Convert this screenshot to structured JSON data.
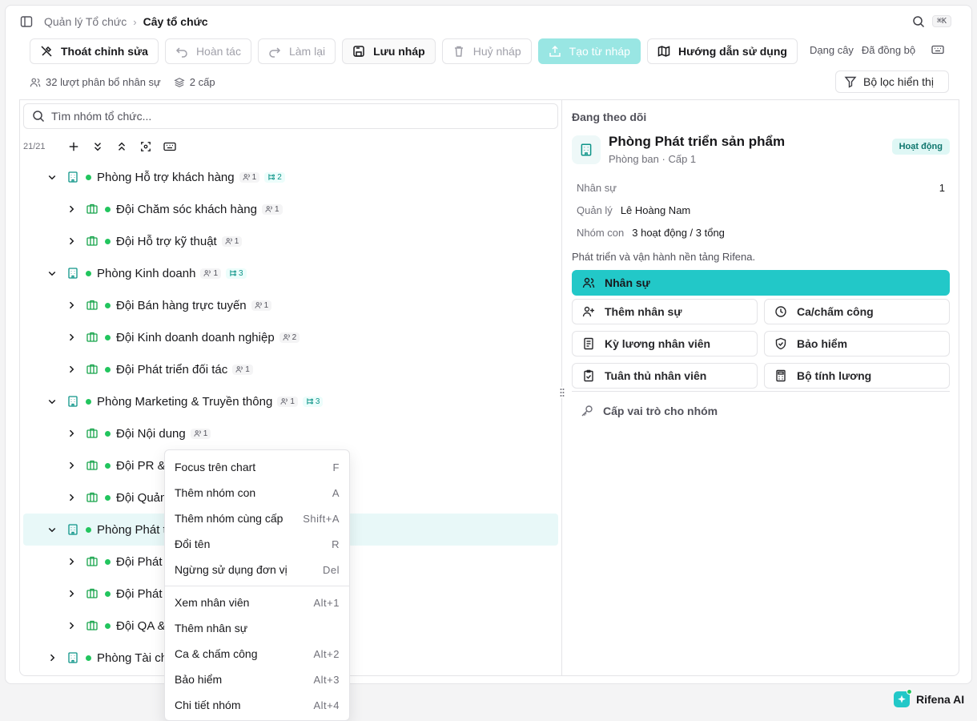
{
  "breadcrumb": {
    "parent": "Quản lý Tổ chức",
    "current": "Cây tổ chức"
  },
  "shortcut_hint": "⌘K",
  "toolbar": {
    "exit_edit": "Thoát chỉnh sửa",
    "undo": "Hoàn tác",
    "redo": "Làm lại",
    "save_draft": "Lưu nháp",
    "cancel_draft": "Huỷ nháp",
    "create_from_draft": "Tạo từ nháp",
    "guide": "Hướng dẫn sử dụng",
    "view_mode": "Dạng cây",
    "sync_status": "Đã đồng bộ"
  },
  "stats": {
    "assignments": "32 lượt phân bổ nhân sự",
    "levels": "2 cấp"
  },
  "filter_label": "Bộ lọc hiển thị",
  "search": {
    "placeholder": "Tìm nhóm tổ chức..."
  },
  "tree_count": "21/21",
  "tree": [
    {
      "name": "Phòng Hỗ trợ khách hàng",
      "level": 0,
      "expanded": true,
      "members": "1",
      "children": "2"
    },
    {
      "name": "Đội Chăm sóc khách hàng",
      "level": 1,
      "members": "1"
    },
    {
      "name": "Đội Hỗ trợ kỹ thuật",
      "level": 1,
      "members": "1"
    },
    {
      "name": "Phòng Kinh doanh",
      "level": 0,
      "expanded": true,
      "members": "1",
      "children": "3"
    },
    {
      "name": "Đội Bán hàng trực tuyến",
      "level": 1,
      "members": "1"
    },
    {
      "name": "Đội Kinh doanh doanh nghiệp",
      "level": 1,
      "members": "2"
    },
    {
      "name": "Đội Phát triển đối tác",
      "level": 1,
      "members": "1"
    },
    {
      "name": "Phòng Marketing & Truyền thông",
      "level": 0,
      "expanded": true,
      "members": "1",
      "children": "3"
    },
    {
      "name": "Đội Nội dung",
      "level": 1,
      "members": "1"
    },
    {
      "name": "Đội PR & S",
      "level": 1
    },
    {
      "name": "Đội Quảng",
      "level": 1
    },
    {
      "name": "Phòng Phát tr",
      "level": 0,
      "expanded": true,
      "selected": true
    },
    {
      "name": "Đội Phát tr",
      "level": 1
    },
    {
      "name": "Đội Phát tr",
      "level": 1
    },
    {
      "name": "Đội QA & K",
      "level": 1
    },
    {
      "name": "Phòng Tài chí",
      "level": 0,
      "expanded": false
    }
  ],
  "detail": {
    "section_title": "Đang theo dõi",
    "name": "Phòng Phát triển sản phẩm",
    "subtitle": "Phòng ban · Cấp 1",
    "status": "Hoạt động",
    "staff_label": "Nhân sự",
    "staff_value": "1",
    "manager_label": "Quản lý",
    "manager_value": "Lê Hoàng Nam",
    "subgroups_label": "Nhóm con",
    "subgroups_value": "3 hoạt động / 3 tổng",
    "description": "Phát triển và vận hành nền tảng Rifena.",
    "actions": {
      "staff": "Nhân sự",
      "add_staff": "Thêm nhân sự",
      "shifts": "Ca/chấm công",
      "payroll": "Kỳ lương nhân viên",
      "insurance": "Bảo hiểm",
      "compliance": "Tuân thủ nhân viên",
      "salary_calc": "Bộ tính lương"
    },
    "assign_role": "Cấp vai trò cho nhóm"
  },
  "context_menu": {
    "group1": [
      {
        "label": "Focus trên chart",
        "shortcut": "F"
      },
      {
        "label": "Thêm nhóm con",
        "shortcut": "A"
      },
      {
        "label": "Thêm nhóm cùng cấp",
        "shortcut": "Shift+A"
      },
      {
        "label": "Đổi tên",
        "shortcut": "R"
      },
      {
        "label": "Ngừng sử dụng đơn vị",
        "shortcut": "Del"
      }
    ],
    "group2": [
      {
        "label": "Xem nhân viên",
        "shortcut": "Alt+1"
      },
      {
        "label": "Thêm nhân sự",
        "shortcut": ""
      },
      {
        "label": "Ca & chấm công",
        "shortcut": "Alt+2"
      },
      {
        "label": "Bảo hiểm",
        "shortcut": "Alt+3"
      },
      {
        "label": "Chi tiết nhóm",
        "shortcut": "Alt+4"
      }
    ]
  },
  "ai_label": "Rifena AI",
  "colors": {
    "accent": "#22c8c8",
    "status_green": "#22c55e",
    "selected_row": "#e8f8f8"
  }
}
